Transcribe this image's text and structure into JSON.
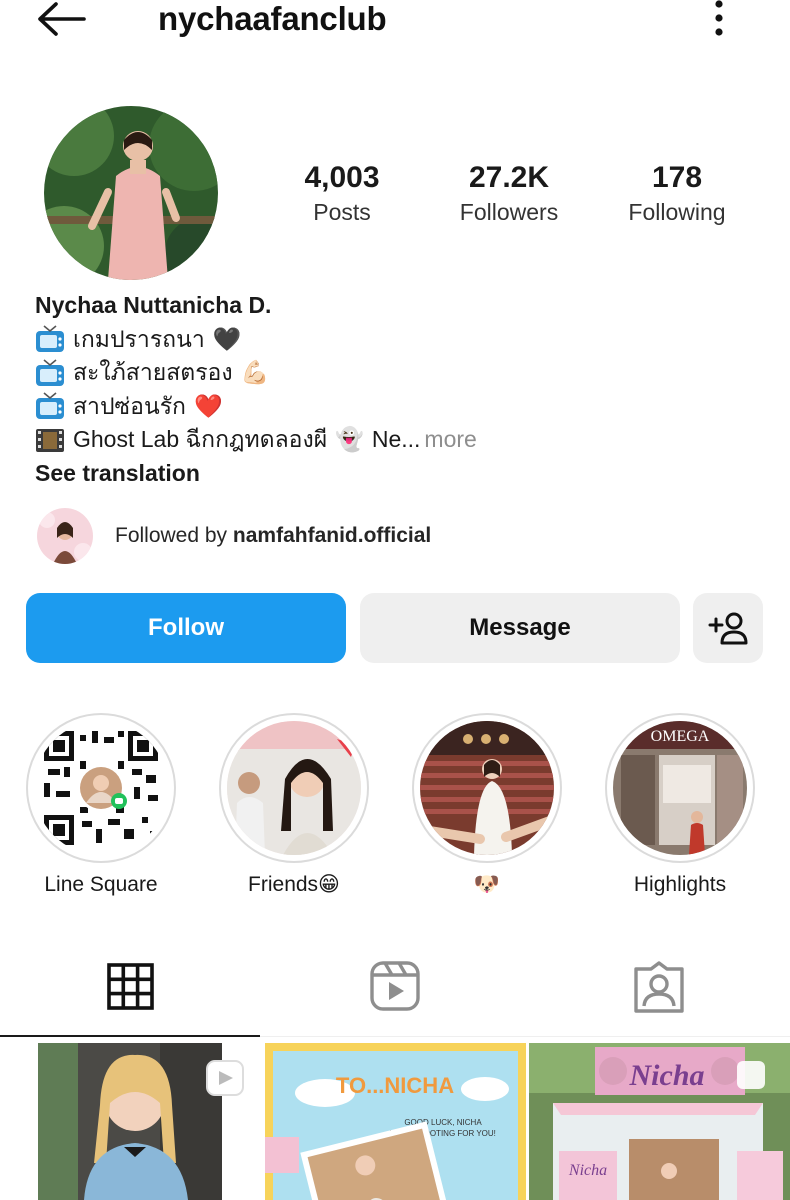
{
  "header": {
    "username": "nychaafanclub",
    "back_icon": "arrow-left-icon",
    "more_icon": "vertical-dots-icon"
  },
  "stats": {
    "posts": {
      "value": "4,003",
      "label": "Posts"
    },
    "followers": {
      "value": "27.2K",
      "label": "Followers"
    },
    "following": {
      "value": "178",
      "label": "Following"
    }
  },
  "bio": {
    "name": "Nychaa Nuttanicha D.",
    "lines": [
      {
        "icon": "tv-icon",
        "text": "เกมปรารถนา",
        "emoji": "🖤"
      },
      {
        "icon": "tv-icon",
        "text": "สะใภ้สายสตรอง",
        "emoji": "💪🏻"
      },
      {
        "icon": "tv-icon",
        "text": "สาปซ่อนรัก",
        "emoji": "❤️"
      },
      {
        "icon": "film-icon",
        "text": "Ghost Lab ฉีกกฎทดลองผี",
        "emoji": "👻",
        "suffix": "Ne...",
        "more": "more"
      }
    ],
    "see_translation": "See translation"
  },
  "followed_by": {
    "prefix": "Followed by",
    "account": "namfahfanid.official"
  },
  "actions": {
    "follow": "Follow",
    "message": "Message",
    "add_user_icon": "add-user-icon"
  },
  "highlights": [
    {
      "label": "Line Square"
    },
    {
      "label": "Friends😁"
    },
    {
      "label": "🐶"
    },
    {
      "label": "Highlights"
    }
  ],
  "post_text": {
    "post2_title": "TO...NICHA",
    "post2_sub1": "GOOD LUCK, NICHA",
    "post2_sub2": "WE'RE ROOTING FOR YOU!",
    "post3_sign": "Nicha",
    "post3_sign_small": "Nicha"
  },
  "tabs": [
    {
      "icon": "grid-icon",
      "active": true
    },
    {
      "icon": "reels-icon",
      "active": false
    },
    {
      "icon": "tagged-icon",
      "active": false
    }
  ],
  "colors": {
    "follow_button": "#1c9bef",
    "secondary_button": "#efefef",
    "muted_text": "#8e8e8e"
  }
}
